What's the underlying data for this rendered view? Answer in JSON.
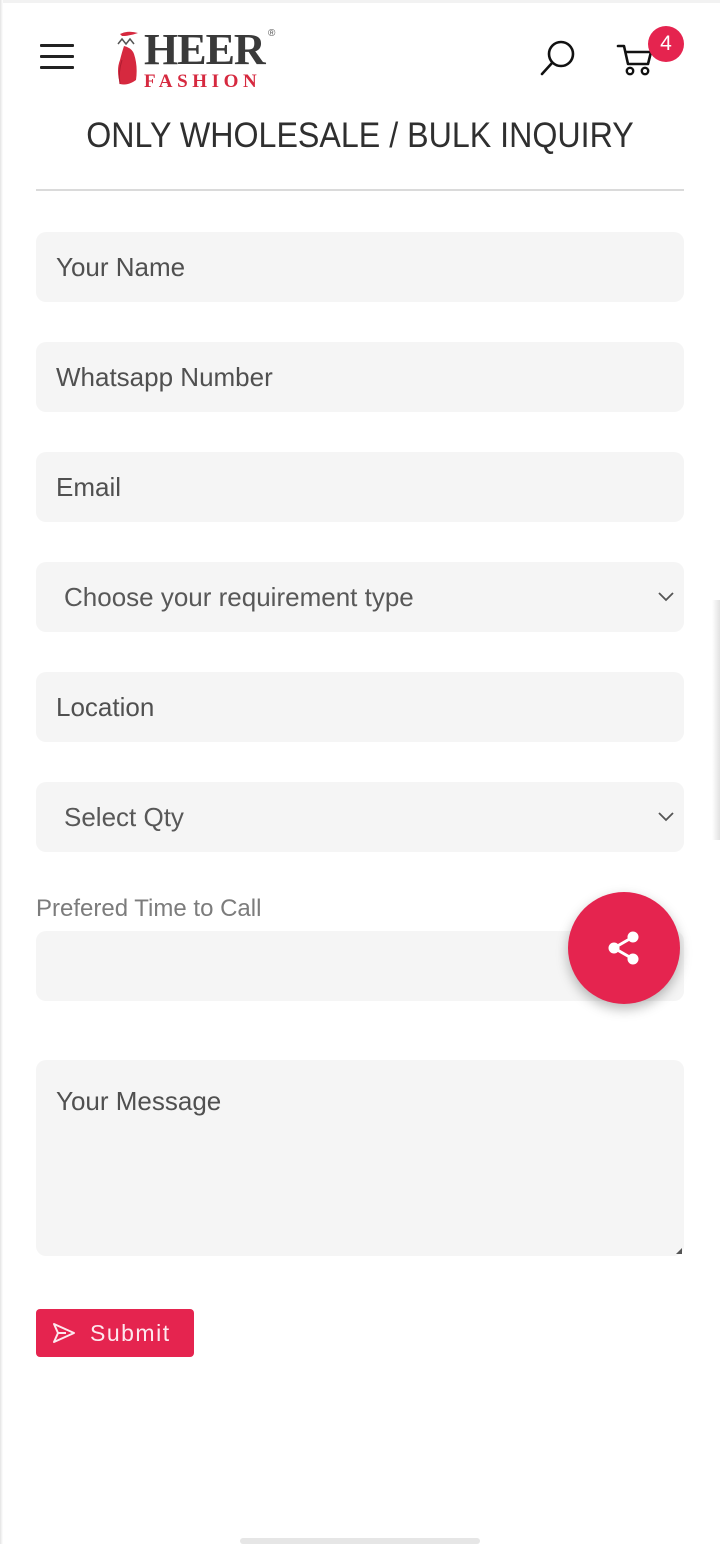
{
  "header": {
    "brand_name": "HEER",
    "brand_sub": "FASHION",
    "brand_reg": "®",
    "menu_icon": "hamburger-menu-icon",
    "search_icon": "search-icon",
    "cart_icon": "cart-icon",
    "cart_count": "4"
  },
  "page": {
    "title": "ONLY WHOLESALE / BULK INQUIRY"
  },
  "form": {
    "name": {
      "placeholder": "Your Name",
      "value": ""
    },
    "whatsapp": {
      "placeholder": "Whatsapp Number",
      "value": ""
    },
    "email": {
      "placeholder": "Email",
      "value": ""
    },
    "requirement_type": {
      "selected": "Choose your requirement type"
    },
    "location": {
      "placeholder": "Location",
      "value": ""
    },
    "quantity": {
      "selected": "Select Qty"
    },
    "call_time": {
      "label": "Prefered Time to Call",
      "value": ""
    },
    "message": {
      "placeholder": "Your Message",
      "value": ""
    },
    "submit_label": "Submit"
  },
  "fab": {
    "icon": "share-icon"
  },
  "colors": {
    "accent": "#e5244f",
    "field_bg": "#f5f5f5",
    "title": "#2f2f2f"
  }
}
